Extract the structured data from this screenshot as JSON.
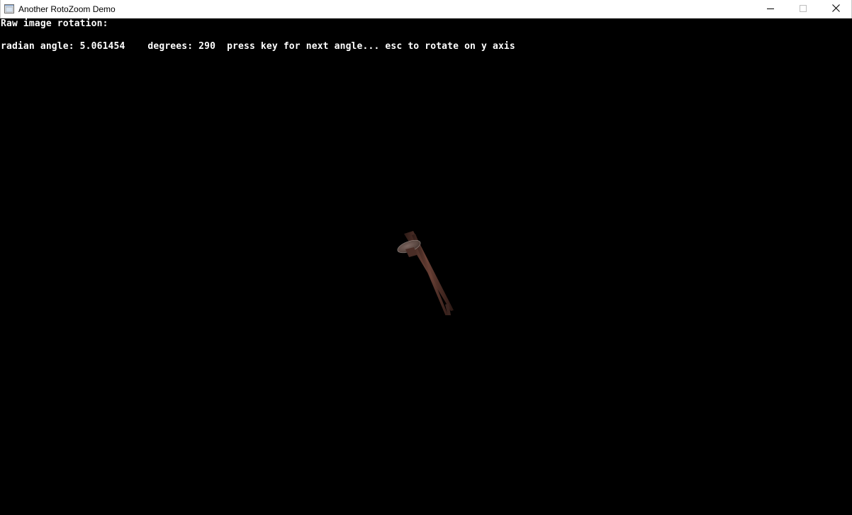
{
  "window": {
    "title": "Another RotoZoom Demo"
  },
  "titlebar": {
    "icon": "app-window-icon",
    "minimize_icon": "minimize-icon",
    "maximize_icon": "maximize-icon",
    "close_icon": "close-icon"
  },
  "console": {
    "line1": "Raw image rotation:",
    "line2": "radian angle: 5.061454    degrees: 290  press key for next angle... esc to rotate on y axis"
  },
  "rotation": {
    "radians": 5.061454,
    "degrees": 290
  },
  "image": {
    "subject": "nail",
    "color_head": "#5c4a44",
    "color_shaft": "#4a2f28"
  }
}
